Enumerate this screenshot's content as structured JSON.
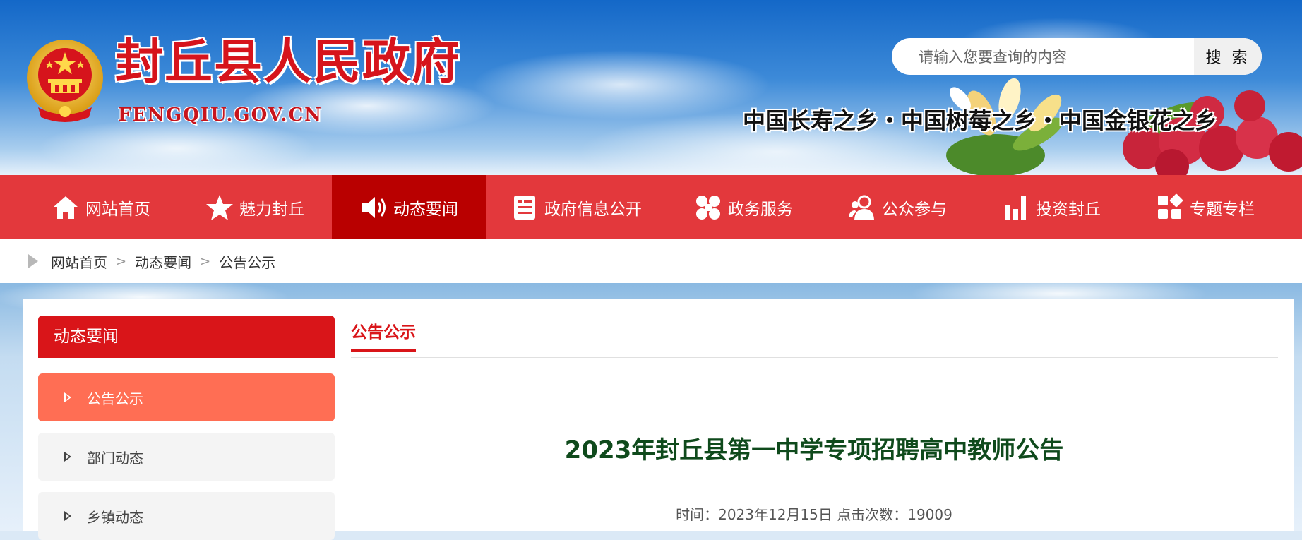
{
  "header": {
    "site_title": "封丘县人民政府",
    "site_domain": "FENGQIU.GOV.CN",
    "slogan": "中国长寿之乡・中国树莓之乡・中国金银花之乡"
  },
  "search": {
    "placeholder": "请输入您要查询的内容",
    "value": "",
    "button_label": "搜 索"
  },
  "nav": {
    "items": [
      {
        "label": "网站首页",
        "icon": "home-icon"
      },
      {
        "label": "魅力封丘",
        "icon": "star-icon"
      },
      {
        "label": "动态要闻",
        "icon": "speaker-icon",
        "active": true
      },
      {
        "label": "政府信息公开",
        "icon": "document-icon"
      },
      {
        "label": "政务服务",
        "icon": "service-icon"
      },
      {
        "label": "公众参与",
        "icon": "people-icon"
      },
      {
        "label": "投资封丘",
        "icon": "bar-chart-icon"
      },
      {
        "label": "专题专栏",
        "icon": "grid-icon"
      }
    ]
  },
  "breadcrumb": [
    "网站首页",
    "动态要闻",
    "公告公示"
  ],
  "sidebar": {
    "title": "动态要闻",
    "items": [
      {
        "label": "公告公示",
        "active": true
      },
      {
        "label": "部门动态"
      },
      {
        "label": "乡镇动态"
      }
    ]
  },
  "main": {
    "tab_title": "公告公示",
    "article_title": "2023年封丘县第一中学专项招聘高中教师公告",
    "article_meta": "时间：2023年12月15日 点击次数：19009"
  },
  "colors": {
    "nav_bg": "#e3383c",
    "nav_active": "#b90000",
    "brand_red": "#d91519",
    "sidebar_active": "#ff6e54",
    "article_title": "#0f4a1c"
  }
}
